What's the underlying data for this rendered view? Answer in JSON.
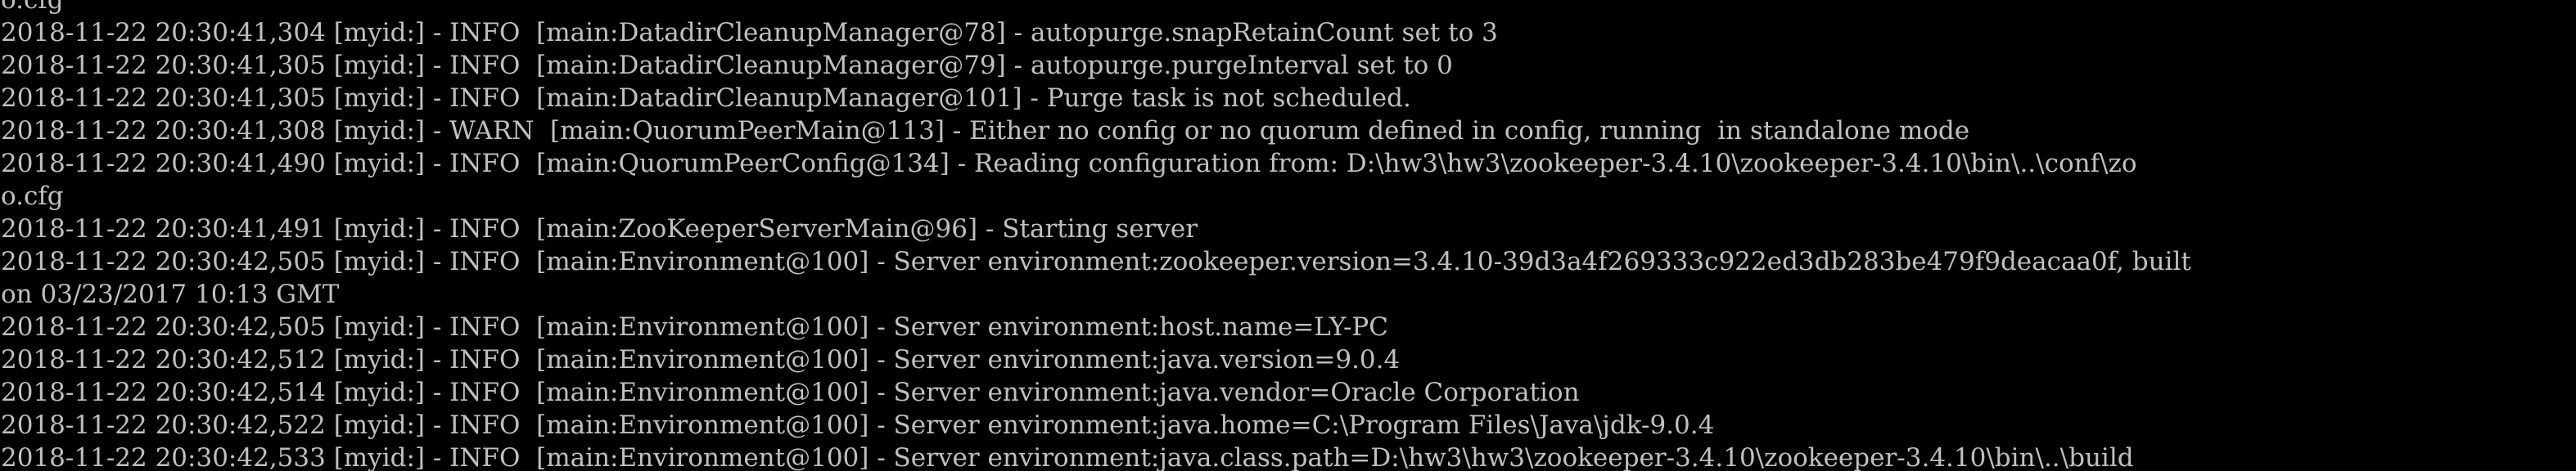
{
  "console": {
    "text_color": "#c0c0c0",
    "background_color": "#000000",
    "lines": [
      "o.cfg",
      "2018-11-22 20:30:41,304 [myid:] - INFO  [main:DatadirCleanupManager@78] - autopurge.snapRetainCount set to 3",
      "2018-11-22 20:30:41,305 [myid:] - INFO  [main:DatadirCleanupManager@79] - autopurge.purgeInterval set to 0",
      "2018-11-22 20:30:41,305 [myid:] - INFO  [main:DatadirCleanupManager@101] - Purge task is not scheduled.",
      "2018-11-22 20:30:41,308 [myid:] - WARN  [main:QuorumPeerMain@113] - Either no config or no quorum defined in config, running  in standalone mode",
      "2018-11-22 20:30:41,490 [myid:] - INFO  [main:QuorumPeerConfig@134] - Reading configuration from: D:\\hw3\\hw3\\zookeeper-3.4.10\\zookeeper-3.4.10\\bin\\..\\conf\\zo",
      "o.cfg",
      "2018-11-22 20:30:41,491 [myid:] - INFO  [main:ZooKeeperServerMain@96] - Starting server",
      "2018-11-22 20:30:42,505 [myid:] - INFO  [main:Environment@100] - Server environment:zookeeper.version=3.4.10-39d3a4f269333c922ed3db283be479f9deacaa0f, built",
      "on 03/23/2017 10:13 GMT",
      "2018-11-22 20:30:42,505 [myid:] - INFO  [main:Environment@100] - Server environment:host.name=LY-PC",
      "2018-11-22 20:30:42,512 [myid:] - INFO  [main:Environment@100] - Server environment:java.version=9.0.4",
      "2018-11-22 20:30:42,514 [myid:] - INFO  [main:Environment@100] - Server environment:java.vendor=Oracle Corporation",
      "2018-11-22 20:30:42,522 [myid:] - INFO  [main:Environment@100] - Server environment:java.home=C:\\Program Files\\Java\\jdk-9.0.4",
      "2018-11-22 20:30:42,533 [myid:] - INFO  [main:Environment@100] - Server environment:java.class.path=D:\\hw3\\hw3\\zookeeper-3.4.10\\zookeeper-3.4.10\\bin\\..\\build"
    ]
  }
}
